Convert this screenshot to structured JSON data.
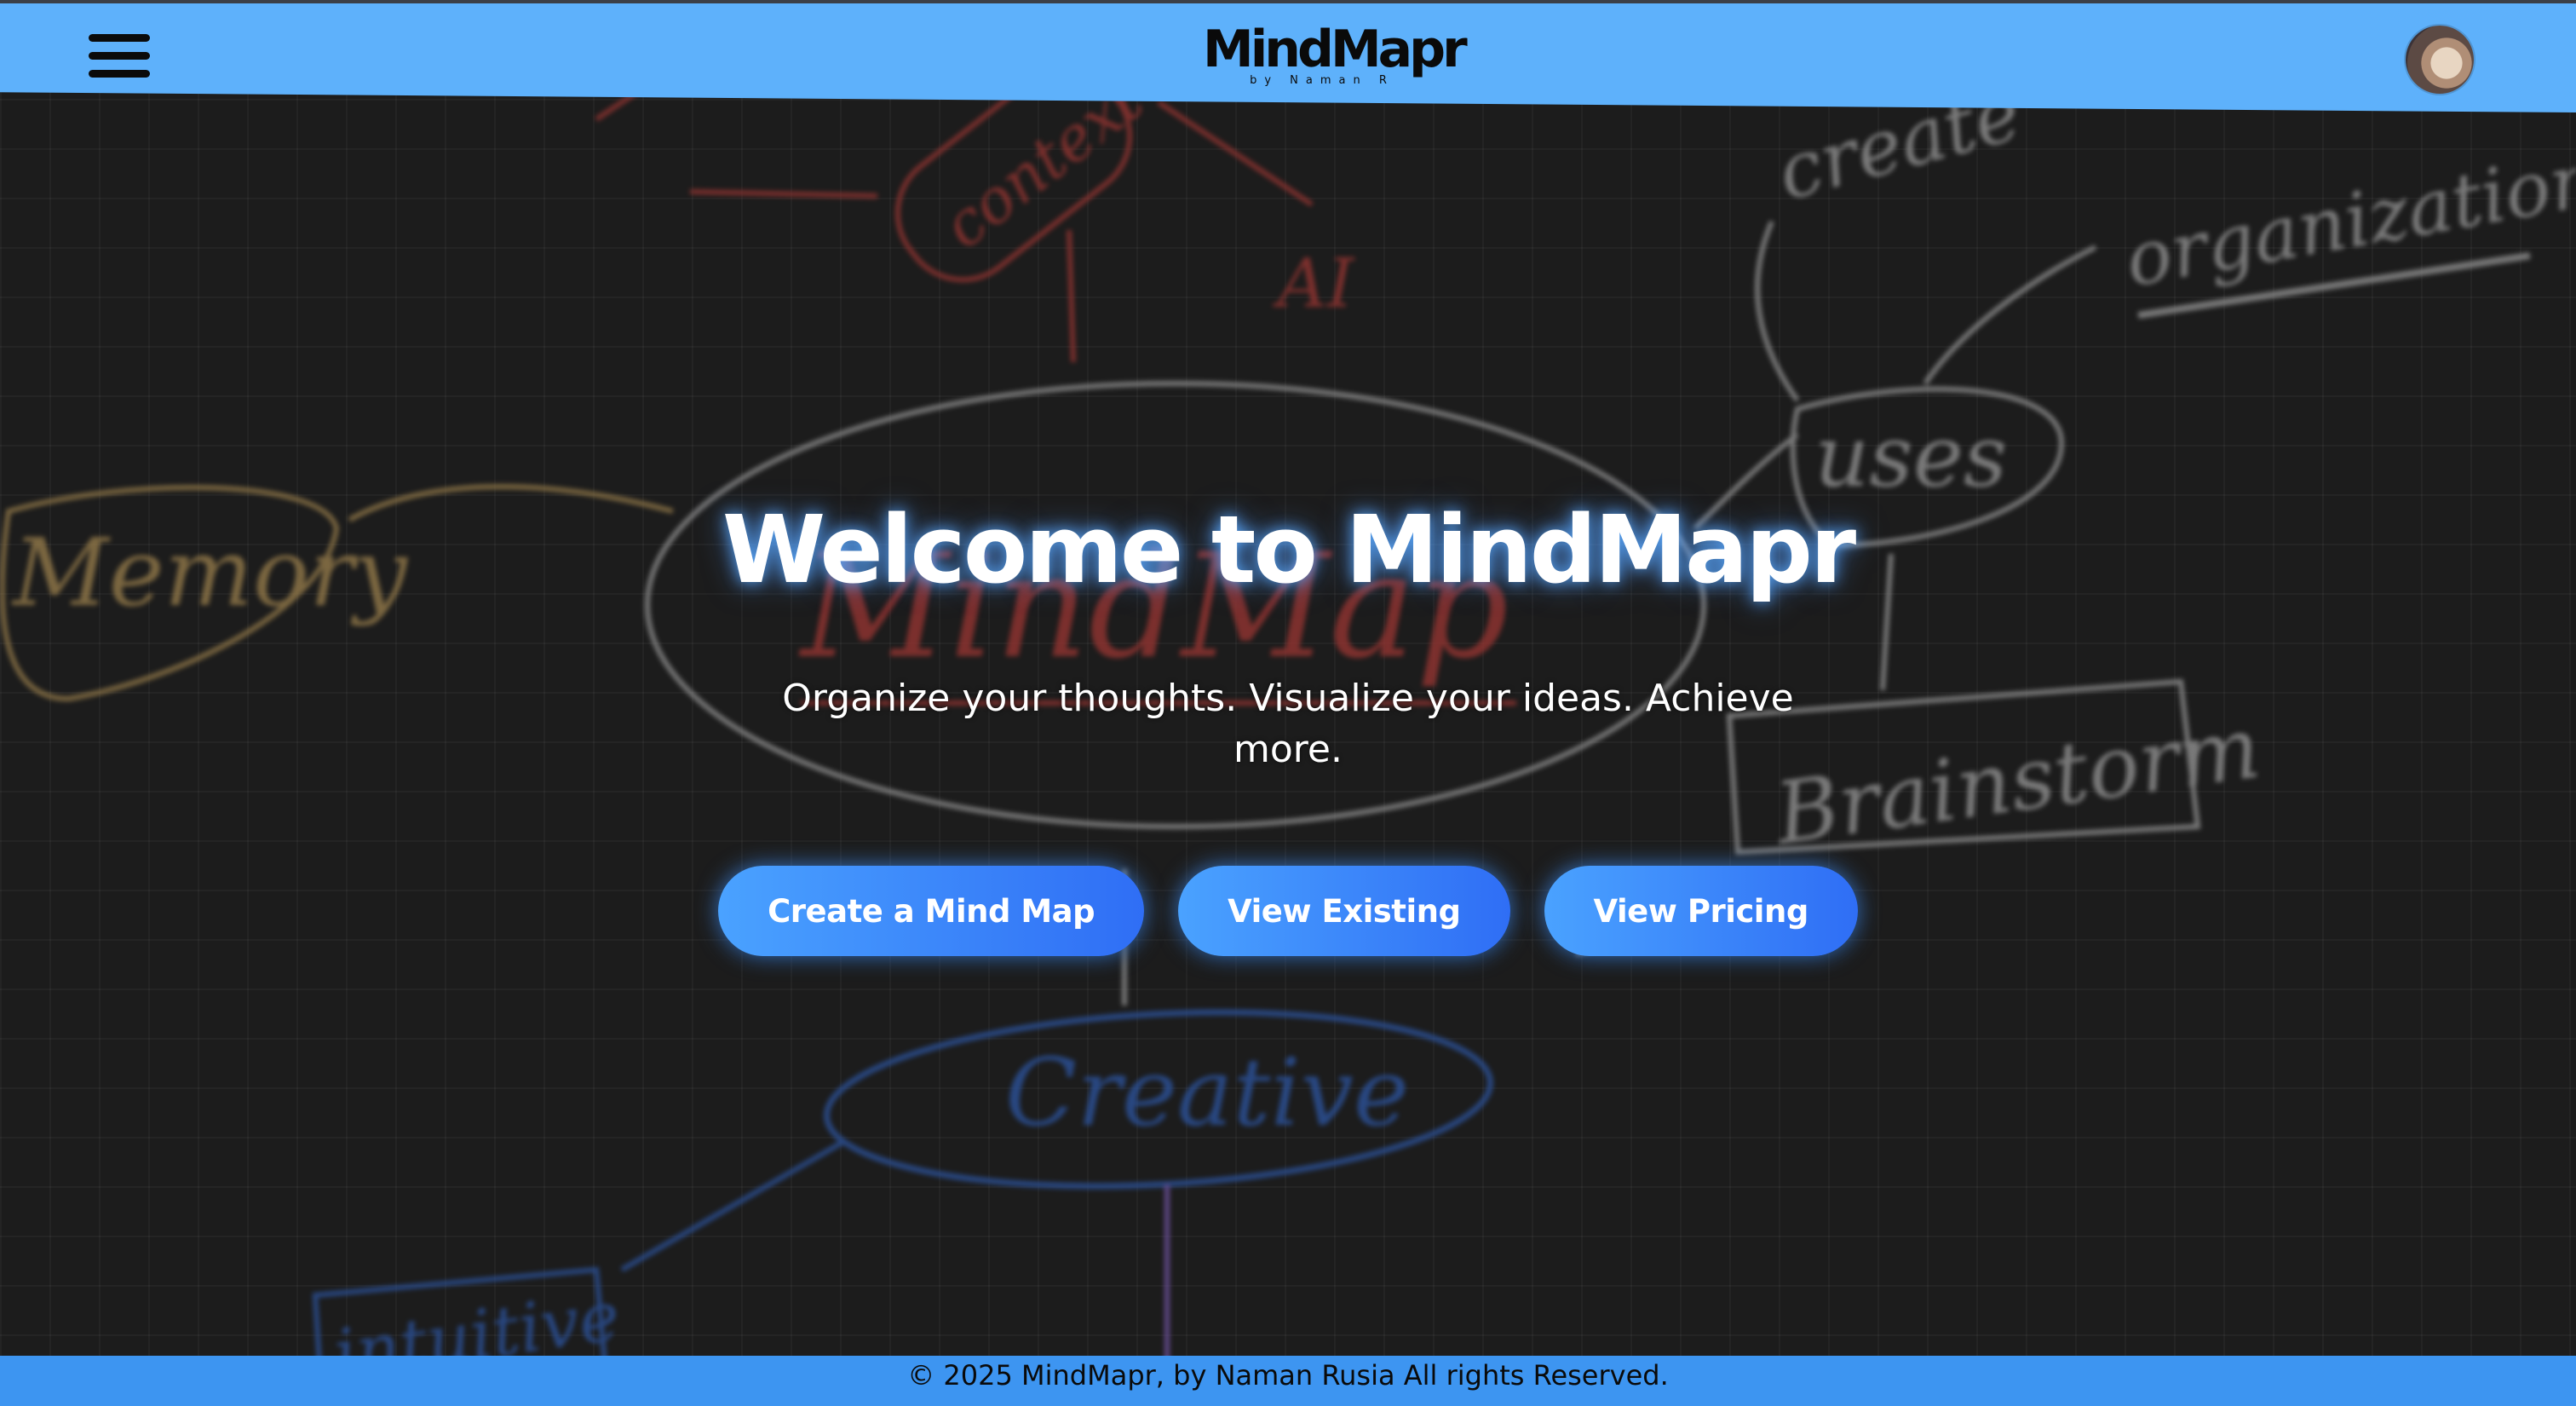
{
  "header": {
    "menu_icon": "hamburger-menu-icon",
    "logo_title": "MindMapr",
    "logo_subtitle": "by Naman R",
    "avatar_icon": "user-avatar"
  },
  "background": {
    "labels": [
      "context",
      "AI",
      "organization",
      "create",
      "uses",
      "Memory",
      "MindMap",
      "Brainstorm",
      "Creative",
      "intuitive"
    ]
  },
  "hero": {
    "title": "Welcome to MindMapr",
    "subtitle": "Organize your thoughts. Visualize your ideas. Achieve more."
  },
  "actions": [
    {
      "label": "Create a Mind Map"
    },
    {
      "label": "View Existing"
    },
    {
      "label": "View Pricing"
    }
  ],
  "footer": {
    "text": "© 2025 MindMapr, by Naman Rusia All rights Reserved."
  },
  "colors": {
    "header_bg": "#5eb1fb",
    "footer_bg": "#3d95f1",
    "page_bg": "#1c1c1c",
    "button_start": "#4aa2ff",
    "button_end": "#2f6ef5"
  }
}
